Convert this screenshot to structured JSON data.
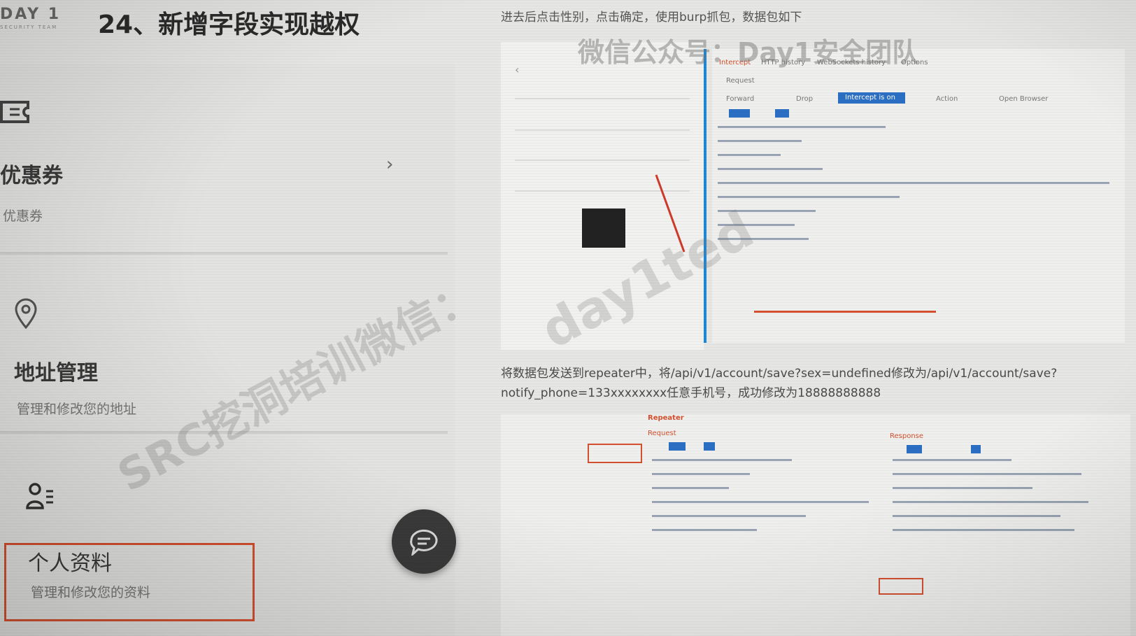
{
  "brand": {
    "name": "DAY 1",
    "subtitle": "SECURITY TEAM"
  },
  "page_title": "24、新增字段实现越权",
  "instruction": "进去后点击性别，点击确定，使用burp抓包，数据包如下",
  "watermarks": {
    "top": "微信公众号：Day1安全团队",
    "diagonal": "SRC挖洞培训微信：",
    "diagonal_id": "day1ted"
  },
  "menu": [
    {
      "title": "优惠券",
      "subtitle": "优惠券",
      "icon": "ticket-icon"
    },
    {
      "title": "地址管理",
      "subtitle": "管理和修改您的地址",
      "icon": "location-pin-icon"
    },
    {
      "title": "个人资料",
      "subtitle": "管理和修改您的资料",
      "icon": "profile-icon",
      "selected": true
    }
  ],
  "repeater_instruction": "将数据包发送到repeater中，将/api/v1/account/save?sex=undefined修改为/api/v1/account/save?notify_phone=133xxxxxxxx任意手机号，成功修改为18888888888",
  "burp": {
    "tabs": [
      "Intercept",
      "HTTP history",
      "WebSockets history",
      "Options"
    ],
    "buttons": [
      "Forward",
      "Drop",
      "Intercept is on",
      "Action",
      "Open Browser"
    ],
    "request_label": "Request",
    "repeater_label": "Repeater",
    "response_label": "Response"
  },
  "colors": {
    "accent_red": "#d4502f",
    "burp_blue": "#2b6fc4",
    "divider_blue": "#1f88d6"
  }
}
